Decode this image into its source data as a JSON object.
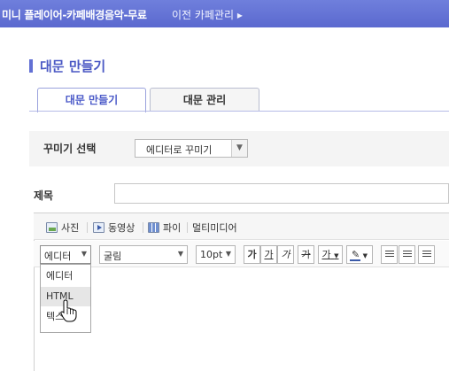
{
  "topbar": {
    "title": "미니 플레이어-카페배경음악-무료",
    "link": "이전 카페관리 ▸"
  },
  "page": {
    "title": "대문 만들기"
  },
  "tabs": [
    {
      "label": "대문 만들기",
      "active": true
    },
    {
      "label": "대문 관리",
      "active": false
    }
  ],
  "decorate": {
    "label": "꾸미기 선택",
    "selected": "에디터로 꾸미기"
  },
  "subject": {
    "label": "제목",
    "value": ""
  },
  "toolbar1": {
    "photo": "사진",
    "video": "동영상",
    "file": "파이",
    "multimedia": "멀티미디어"
  },
  "toolbar2": {
    "mode": "에디터",
    "font": "굴림",
    "size": "10pt",
    "bold": "가",
    "underline": "가",
    "italic": "가",
    "strike": "가",
    "fontcolor": "가"
  },
  "mode_menu": {
    "options": [
      "에디터",
      "HTML",
      "텍스트"
    ],
    "hovered": "HTML"
  },
  "colors": {
    "topbar": "#6474d6",
    "accent": "#4a58c4"
  }
}
